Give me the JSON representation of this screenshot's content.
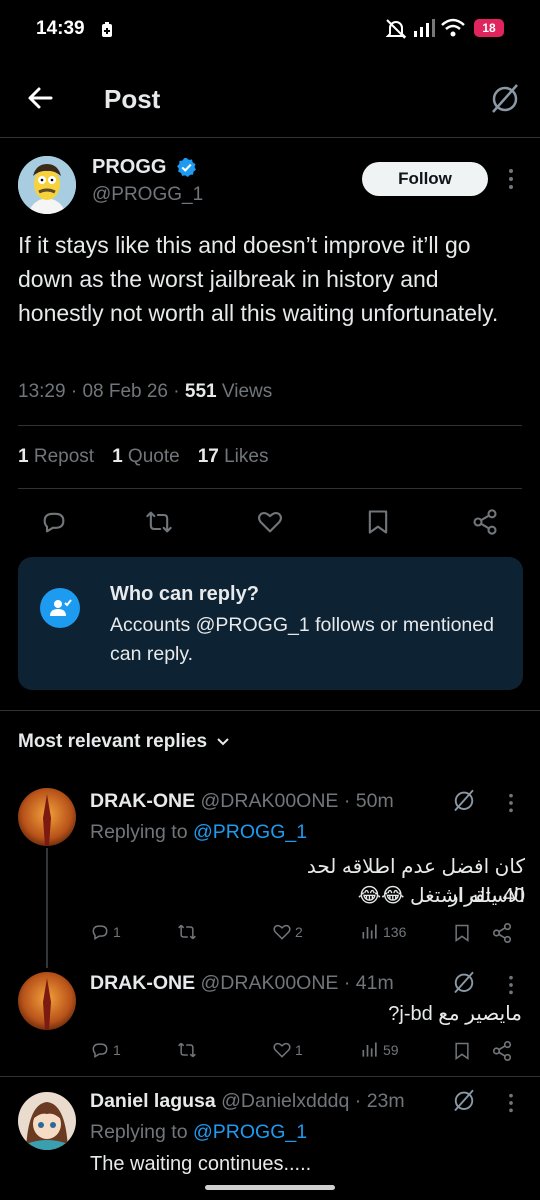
{
  "status_bar": {
    "time": "14:39",
    "battery": "18"
  },
  "header": {
    "title": "Post"
  },
  "post": {
    "author_name": "PROGG",
    "author_handle": "@PROGG_1",
    "follow_label": "Follow",
    "text": "If it stays like this and doesn’t improve it’ll go down as the worst jailbreak in history and honestly not worth all this waiting unfortunately.",
    "time": "13:29",
    "date": "08 Feb 26",
    "sep": "·",
    "views_count": "551",
    "views_label": "Views",
    "reposts_count": "1",
    "reposts_label": "Repost",
    "quotes_count": "1",
    "quotes_label": "Quote",
    "likes_count": "17",
    "likes_label": "Likes"
  },
  "who_can_reply": {
    "title": "Who can reply?",
    "body": "Accounts @PROGG_1 follows or mentioned can reply."
  },
  "replies_filter": {
    "label": "Most relevant replies"
  },
  "replies": [
    {
      "name": "DRAK-ONE",
      "handle": "@DRAK00ONE",
      "age": "· 50m",
      "replying_prefix": "Replying to",
      "replying_to": "@PROGG_1",
      "text_line1": "كان افضل عدم اطلاقه لحد الاستقرار",
      "text_line2": "40 ياله اشتغل 😂😂",
      "comments": "1",
      "reposts": "",
      "likes": "2",
      "views": "136"
    },
    {
      "name": "DRAK-ONE",
      "handle": "@DRAK00ONE",
      "age": "· 41m",
      "text_line1": "مايصير مع j-bd?",
      "comments": "1",
      "reposts": "",
      "likes": "1",
      "views": "59"
    },
    {
      "name": "Daniel lagusa",
      "handle": "@Danielxdddq",
      "age": "· 23m",
      "replying_prefix": "Replying to",
      "replying_to": "@PROGG_1",
      "text_line1": "The waiting continues....."
    }
  ],
  "colors": {
    "accent": "#1d9bf0",
    "background": "#000000",
    "muted": "#71767b",
    "card": "#0d2233",
    "battery": "#e0245e"
  },
  "icons": [
    "back-arrow-icon",
    "grok-icon",
    "verified-badge-icon",
    "more-icon",
    "reply-icon",
    "repost-icon",
    "like-icon",
    "bookmark-icon",
    "share-icon",
    "add-user-icon",
    "chevron-down-icon",
    "views-icon"
  ]
}
